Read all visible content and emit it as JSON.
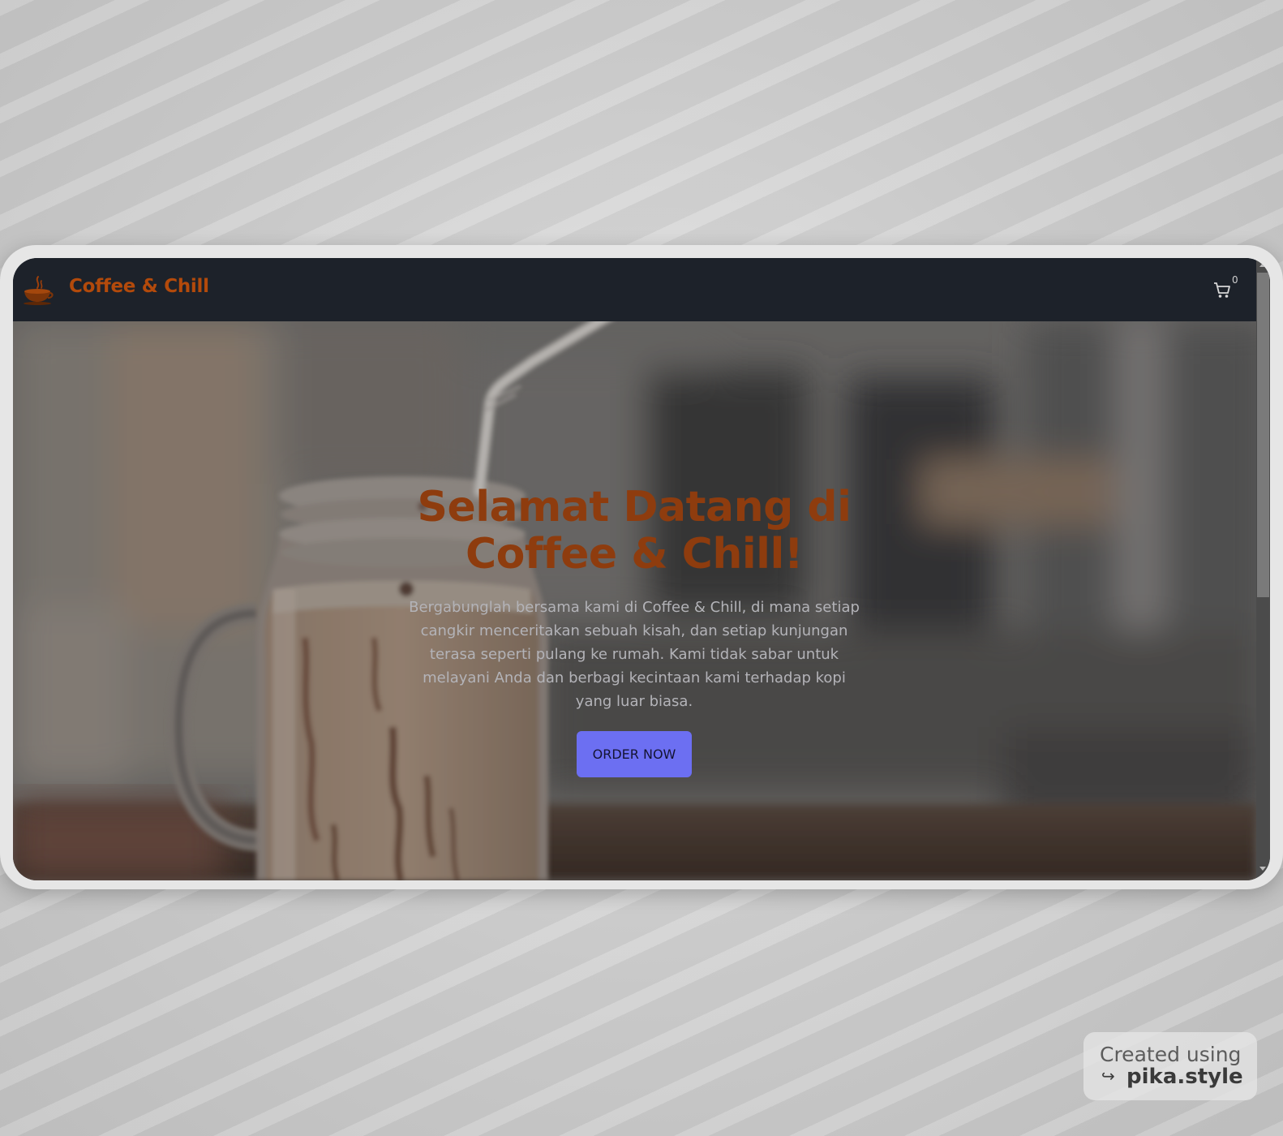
{
  "navbar": {
    "brand": "Coffee & Chill",
    "logo_icon": "coffee-cup-icon",
    "cart_icon": "shopping-cart-icon",
    "cart_count": "0"
  },
  "hero": {
    "title_line1": "Selamat Datang di",
    "title_line2": "Coffee & Chill!",
    "description": "Bergabunglah bersama kami di Coffee & Chill, di mana setiap cangkir menceritakan sebuah kisah, dan setiap kunjungan terasa seperti pulang ke rumah. Kami tidak sabar untuk melayani Anda dan berbagi kecintaan kami terhadap kopi yang luar biasa.",
    "cta_label": "ORDER NOW"
  },
  "watermark": {
    "line1": "Created using",
    "arrow": "↪",
    "line2": "pika.style"
  },
  "colors": {
    "navbar_bg": "#1d222a",
    "brand": "#b34a0b",
    "hero_title": "#8e3c0e",
    "hero_text": "#b3b3b8",
    "cta_bg": "#6c6ff2",
    "cta_text": "#141433"
  }
}
